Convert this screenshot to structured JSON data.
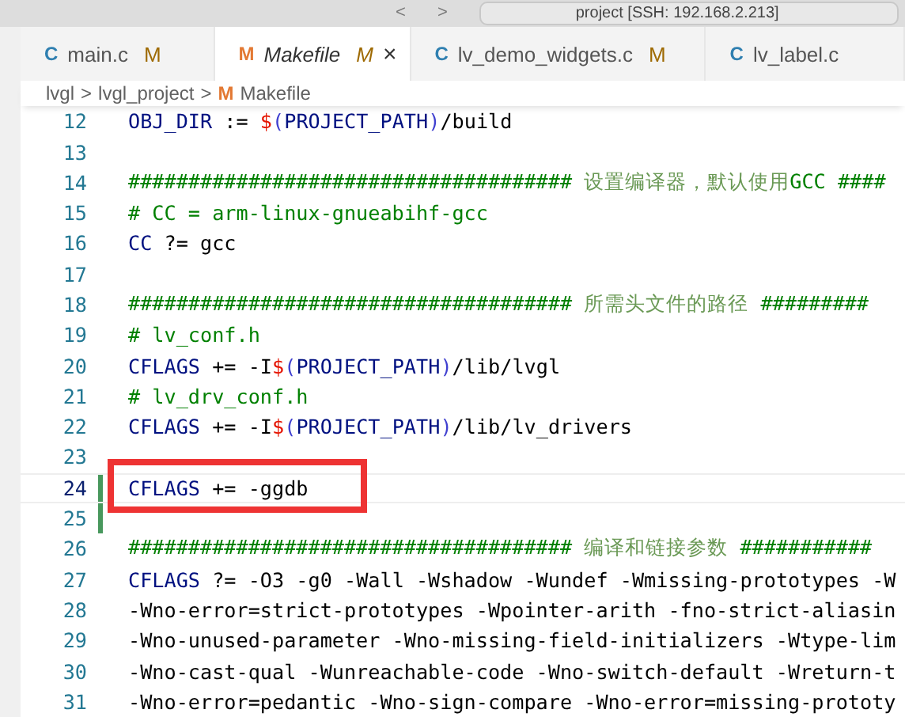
{
  "title_bar": {
    "nav": [
      "<",
      ">"
    ],
    "search": "project [SSH: 192.168.2.213]"
  },
  "tabs": [
    {
      "icon": "C",
      "color": "#2f7fb0",
      "label": "main.c",
      "badge": "M",
      "selected": false,
      "preview": false
    },
    {
      "icon": "M",
      "color": "#e37933",
      "label": "Makefile",
      "badge": "M",
      "selected": true,
      "preview": true,
      "close": "×"
    },
    {
      "icon": "C",
      "color": "#2f7fb0",
      "label": "lv_demo_widgets.c",
      "badge": "M",
      "selected": false,
      "preview": false
    },
    {
      "icon": "C",
      "color": "#2f7fb0",
      "label": "lv_label.c",
      "selected": false,
      "preview": false
    }
  ],
  "breadcrumb": [
    {
      "label": "lvgl"
    },
    {
      "label": "lvgl_project"
    },
    {
      "icon": "M",
      "label": "Makefile"
    }
  ],
  "breadcrumb_separator": ">",
  "lines": [
    {
      "number": "12",
      "current": false,
      "modified": false,
      "tokens": [
        {
          "kind": "var",
          "text": "OBJ_DIR"
        },
        {
          "kind": "plain",
          "text": " := "
        },
        {
          "kind": "dollar",
          "text": "$"
        },
        {
          "kind": "paren",
          "text": "("
        },
        {
          "kind": "var",
          "text": "PROJECT_PATH"
        },
        {
          "kind": "paren",
          "text": ")"
        },
        {
          "kind": "plain",
          "text": "/build"
        }
      ]
    },
    {
      "number": "13",
      "current": false,
      "modified": false
    },
    {
      "number": "14",
      "current": false,
      "modified": false,
      "tokens": [
        {
          "kind": "comment",
          "text": "#####################################"
        },
        {
          "kind": "note",
          "text": " 设置编译器，默认使用"
        },
        {
          "kind": "comment",
          "text": "GCC ####"
        }
      ]
    },
    {
      "number": "15",
      "current": false,
      "modified": false,
      "tokens": [
        {
          "kind": "comment",
          "text": "# CC = arm-linux-gnueabihf-gcc"
        }
      ]
    },
    {
      "number": "16",
      "current": false,
      "modified": false,
      "tokens": [
        {
          "kind": "var",
          "text": "CC"
        },
        {
          "kind": "plain",
          "text": " ?= gcc"
        }
      ]
    },
    {
      "number": "17",
      "current": false,
      "modified": false
    },
    {
      "number": "18",
      "current": false,
      "modified": false,
      "tokens": [
        {
          "kind": "comment",
          "text": "#####################################"
        },
        {
          "kind": "note",
          "text": " 所需头文件的路径 "
        },
        {
          "kind": "comment",
          "text": "#########"
        }
      ]
    },
    {
      "number": "19",
      "current": false,
      "modified": false,
      "tokens": [
        {
          "kind": "comment",
          "text": "# lv_conf.h"
        }
      ]
    },
    {
      "number": "20",
      "current": false,
      "modified": false,
      "tokens": [
        {
          "kind": "var",
          "text": "CFLAGS"
        },
        {
          "kind": "plain",
          "text": " += -I"
        },
        {
          "kind": "dollar",
          "text": "$"
        },
        {
          "kind": "paren",
          "text": "("
        },
        {
          "kind": "var",
          "text": "PROJECT_PATH"
        },
        {
          "kind": "paren",
          "text": ")"
        },
        {
          "kind": "plain",
          "text": "/lib/lvgl"
        }
      ]
    },
    {
      "number": "21",
      "current": false,
      "modified": false,
      "tokens": [
        {
          "kind": "comment",
          "text": "# lv_drv_conf.h"
        }
      ]
    },
    {
      "number": "22",
      "current": false,
      "modified": false,
      "tokens": [
        {
          "kind": "var",
          "text": "CFLAGS"
        },
        {
          "kind": "plain",
          "text": " += -I"
        },
        {
          "kind": "dollar",
          "text": "$"
        },
        {
          "kind": "paren",
          "text": "("
        },
        {
          "kind": "var",
          "text": "PROJECT_PATH"
        },
        {
          "kind": "paren",
          "text": ")"
        },
        {
          "kind": "plain",
          "text": "/lib/lv_drivers"
        }
      ]
    },
    {
      "number": "23",
      "current": false,
      "modified": false
    },
    {
      "number": "24",
      "current": true,
      "modified": true,
      "tokens": [
        {
          "kind": "var",
          "text": "CFLAGS"
        },
        {
          "kind": "plain",
          "text": " += -ggdb"
        }
      ]
    },
    {
      "number": "25",
      "current": false,
      "modified": true
    },
    {
      "number": "26",
      "current": false,
      "modified": false,
      "tokens": [
        {
          "kind": "comment",
          "text": "#####################################"
        },
        {
          "kind": "note",
          "text": " 编译和链接参数 "
        },
        {
          "kind": "comment",
          "text": "###########"
        }
      ]
    },
    {
      "number": "27",
      "current": false,
      "modified": false,
      "tokens": [
        {
          "kind": "var",
          "text": "CFLAGS"
        },
        {
          "kind": "plain",
          "text": " ?= -O3 -g0 -Wall -Wshadow -Wundef -Wmissing-prototypes -W"
        }
      ]
    },
    {
      "number": "28",
      "current": false,
      "modified": false,
      "tokens": [
        {
          "kind": "plain",
          "text": "-Wno-error=strict-prototypes -Wpointer-arith -fno-strict-aliasin"
        }
      ]
    },
    {
      "number": "29",
      "current": false,
      "modified": false,
      "tokens": [
        {
          "kind": "plain",
          "text": "-Wno-unused-parameter -Wno-missing-field-initializers -Wtype-lim"
        }
      ]
    },
    {
      "number": "30",
      "current": false,
      "modified": false,
      "tokens": [
        {
          "kind": "plain",
          "text": "-Wno-cast-qual -Wunreachable-code -Wno-switch-default -Wreturn-t"
        }
      ]
    },
    {
      "number": "31",
      "current": false,
      "modified": false,
      "tokens": [
        {
          "kind": "plain",
          "text": "-Wno-error=pedantic -Wno-sign-compare -Wno-error=missing-prototy"
        }
      ]
    }
  ]
}
